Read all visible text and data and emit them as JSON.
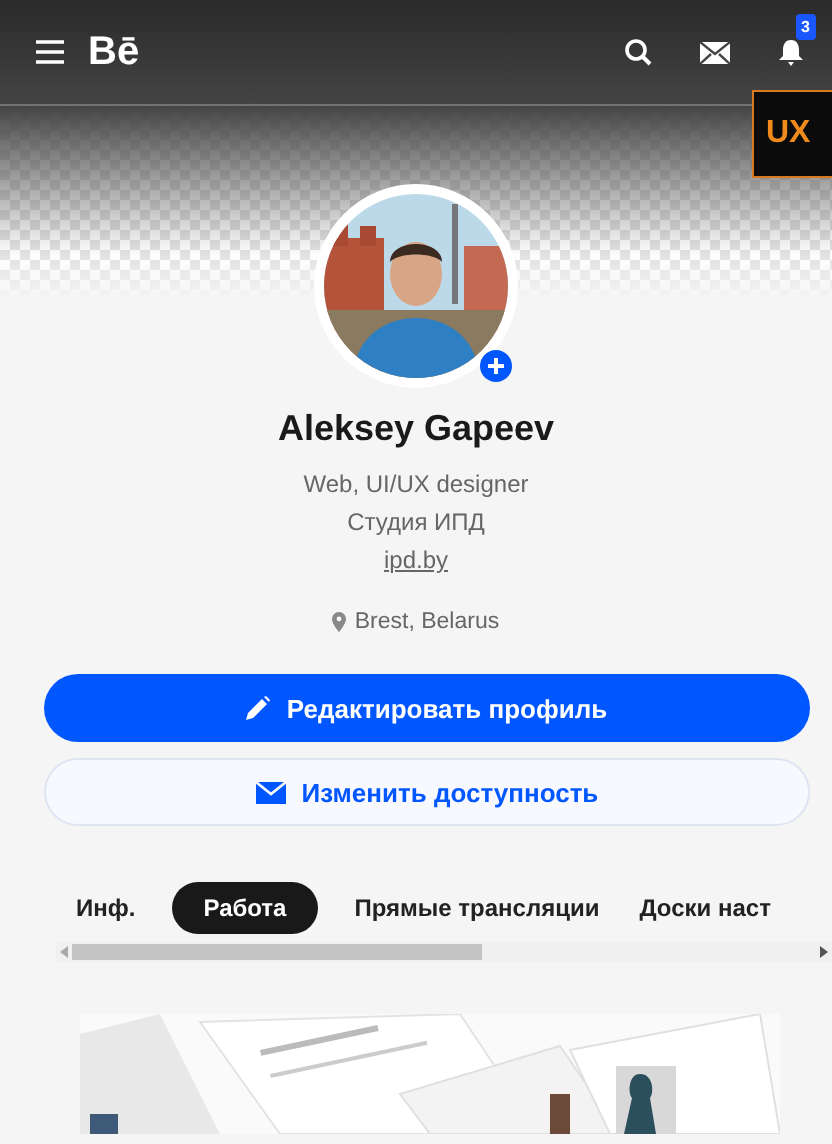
{
  "header": {
    "logo": "Bē",
    "notification_count": "3"
  },
  "banner": {
    "text": "UX"
  },
  "profile": {
    "name": "Aleksey Gapeev",
    "lines": [
      "Web, UI/UX designer",
      "Студия ИПД"
    ],
    "link": "ipd.by",
    "location": "Brest, Belarus"
  },
  "buttons": [
    {
      "label": "Редактировать профиль",
      "kind": "primary"
    },
    {
      "label": "Изменить доступность",
      "kind": "secondary"
    }
  ],
  "tabs": [
    {
      "label": "Инф.",
      "selected": false
    },
    {
      "label": "Работа",
      "selected": true
    },
    {
      "label": "Прямые трансляции",
      "selected": false
    },
    {
      "label": "Доски наст",
      "selected": false
    }
  ]
}
